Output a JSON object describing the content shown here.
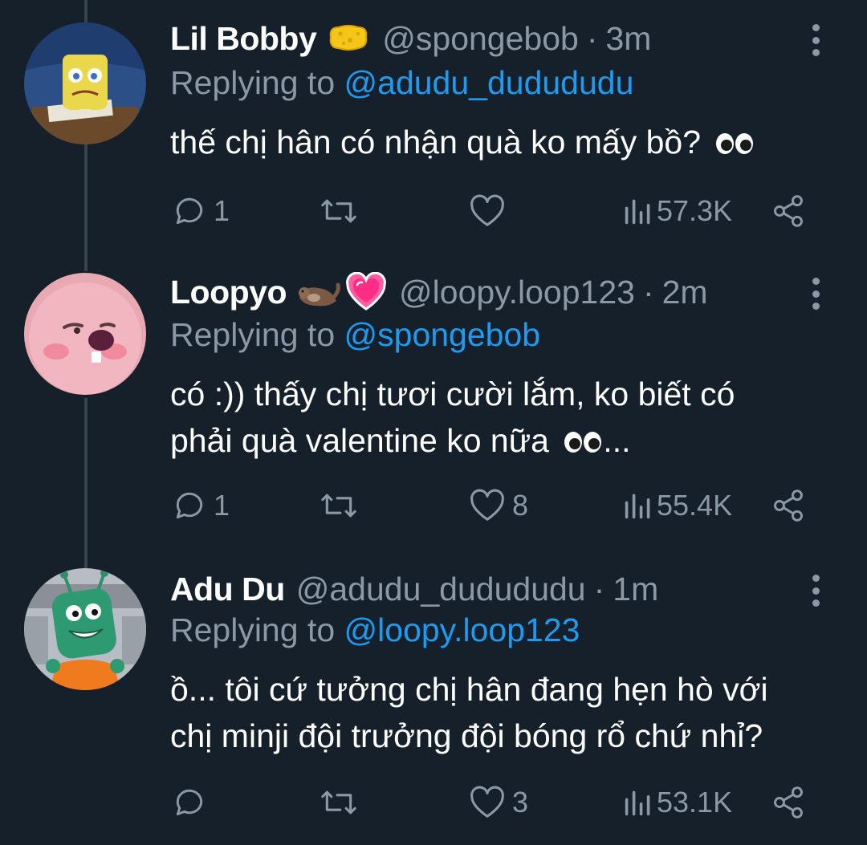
{
  "tweets": [
    {
      "name": "Lil Bobby",
      "name_emoji": "sponge",
      "handle": "@spongebob",
      "separator": "·",
      "time": "3m",
      "replying_prefix": "Replying to",
      "replying_to": "@adudu_dudududu",
      "text": "thế chị hân có nhận quà ko mấy bồ?",
      "text_emoji": "eyes",
      "text_suffix": "",
      "replies": "1",
      "retweets": "",
      "likes": "",
      "views": "57.3K"
    },
    {
      "name": "Loopyo",
      "name_emoji": "otter heart",
      "handle": "@loopy.loop123",
      "separator": "·",
      "time": "2m",
      "replying_prefix": "Replying to",
      "replying_to": "@spongebob",
      "text_line1": "có :)) thấy chị tươi cười lắm, ko biết có",
      "text_line2": "phải quà valentine ko nữa",
      "text_emoji": "eyes",
      "text_suffix": "...",
      "replies": "1",
      "retweets": "",
      "likes": "8",
      "views": "55.4K"
    },
    {
      "name": "Adu Du",
      "handle": "@adudu_dudududu",
      "separator": "·",
      "time": "1m",
      "replying_prefix": "Replying to",
      "replying_to": "@loopy.loop123",
      "text_line1": "ồ... tôi cứ tưởng chị hân đang hẹn hò với",
      "text_line2": "chị minji đội trưởng đội bóng rổ chứ nhỉ?",
      "replies": "",
      "retweets": "",
      "likes": "3",
      "views": "53.1K"
    }
  ],
  "icons": {
    "reply": "speech-bubble-icon",
    "retweet": "retweet-arrows-icon",
    "like": "heart-icon",
    "views": "bar-chart-icon",
    "share": "share-nodes-icon",
    "more": "vertical-dots-icon"
  },
  "colors": {
    "background": "#15202b",
    "text": "#ffffff",
    "secondary": "#8b98a5",
    "link": "#1d9bf0",
    "thread_line": "#38444d"
  }
}
